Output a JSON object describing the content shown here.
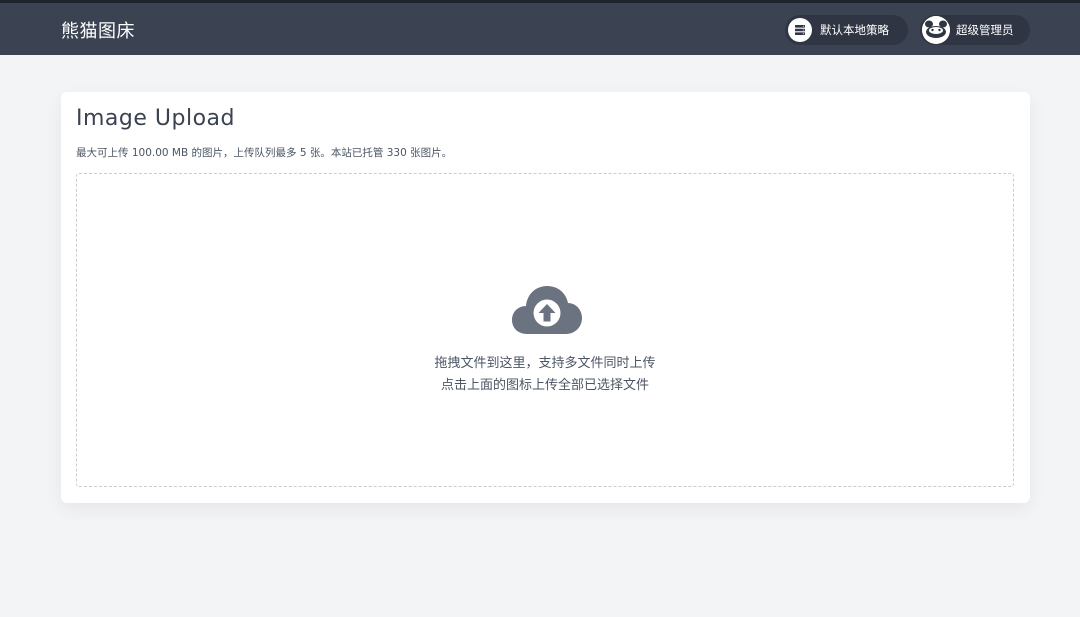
{
  "header": {
    "brand": "熊猫图床",
    "strategy_label": "默认本地策略",
    "user_label": "超级管理员",
    "strategy_icon": "storage-icon",
    "user_icon": "avatar-icon"
  },
  "card": {
    "title": "Image Upload",
    "subtitle": "最大可上传 100.00 MB 的图片，上传队列最多 5 张。本站已托管 330 张图片。"
  },
  "dropzone": {
    "icon": "cloud-upload-icon",
    "line1": "拖拽文件到这里，支持多文件同时上传",
    "line2": "点击上面的图标上传全部已选择文件"
  },
  "colors": {
    "header_bg": "#3b4251",
    "page_bg": "#f3f4f6",
    "icon_gray": "#6b7280"
  }
}
